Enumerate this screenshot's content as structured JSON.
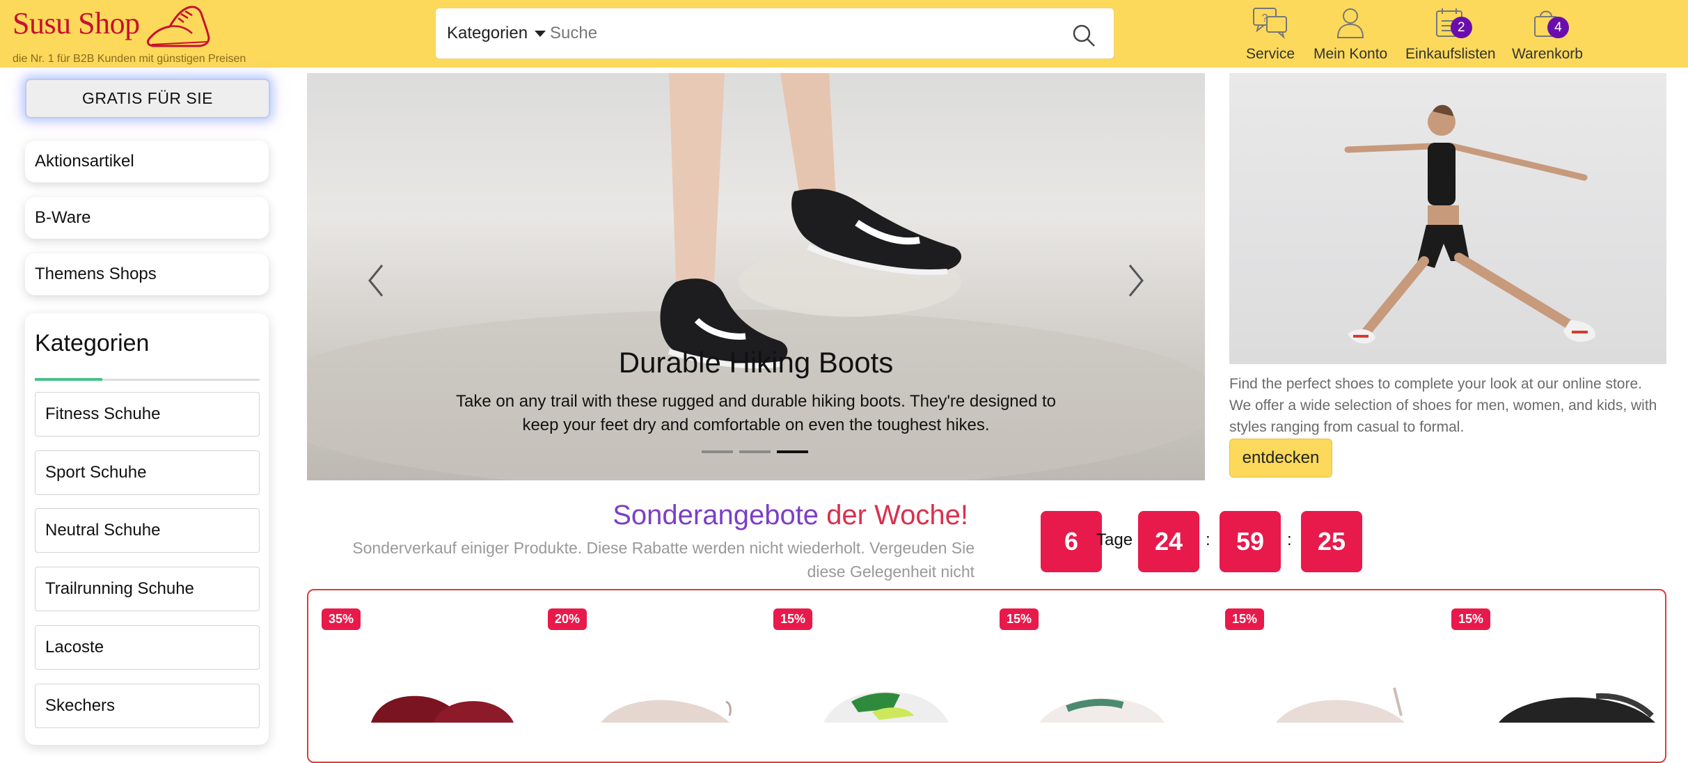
{
  "header": {
    "logo_text": "Susu Shop",
    "tagline": "die Nr. 1 für B2B Kunden mit günstigen Preisen",
    "search": {
      "category_label": "Kategorien",
      "placeholder": "Suche"
    },
    "nav": [
      {
        "label": "Service",
        "icon": "chat-question-icon"
      },
      {
        "label": "Mein Konto",
        "icon": "user-icon"
      },
      {
        "label": "Einkaufslisten",
        "icon": "list-icon",
        "badge": "2"
      },
      {
        "label": "Warenkorb",
        "icon": "bag-icon",
        "badge": "4"
      }
    ],
    "colors": {
      "background": "#fcd95a",
      "logo": "#c8102e",
      "badge": "#6a0dad"
    }
  },
  "sidebar": {
    "gratis_label": "GRATIS FÜR SIE",
    "links": [
      "Aktionsartikel",
      "B-Ware",
      "Themens Shops"
    ],
    "categories": {
      "title": "Kategorien",
      "items": [
        "Fitness Schuhe",
        "Sport Schuhe",
        "Neutral Schuhe",
        "Trailrunning Schuhe",
        "Lacoste",
        "Skechers"
      ]
    }
  },
  "hero": {
    "title": "Durable Hiking Boots",
    "text": "Take on any trail with these rugged and durable hiking boots. They're designed to keep your feet dry and comfortable on even the toughest hikes.",
    "slides": 3,
    "active_slide": 3
  },
  "promo": {
    "text": "Find the perfect shoes to complete your look at our online store. We offer a wide selection of shoes for men, women, and kids, with styles ranging from casual to formal.",
    "button": "entdecken"
  },
  "deals": {
    "title_part1": "Sonderangebote",
    "title_part2": "der Woche!",
    "subtitle": "Sonderverkauf einiger Produkte. Diese Rabatte werden nicht wiederholt. Vergeuden Sie diese Gelegenheit nicht",
    "countdown": {
      "days": "6",
      "days_label": "Tage",
      "hours": "24",
      "minutes": "59",
      "seconds": "25",
      "separator": ":"
    },
    "products": [
      {
        "discount": "35%"
      },
      {
        "discount": "20%"
      },
      {
        "discount": "15%"
      },
      {
        "discount": "15%"
      },
      {
        "discount": "15%"
      },
      {
        "discount": "15%"
      }
    ],
    "colors": {
      "accent": "#e8194b",
      "border": "#dd3b3b"
    }
  }
}
